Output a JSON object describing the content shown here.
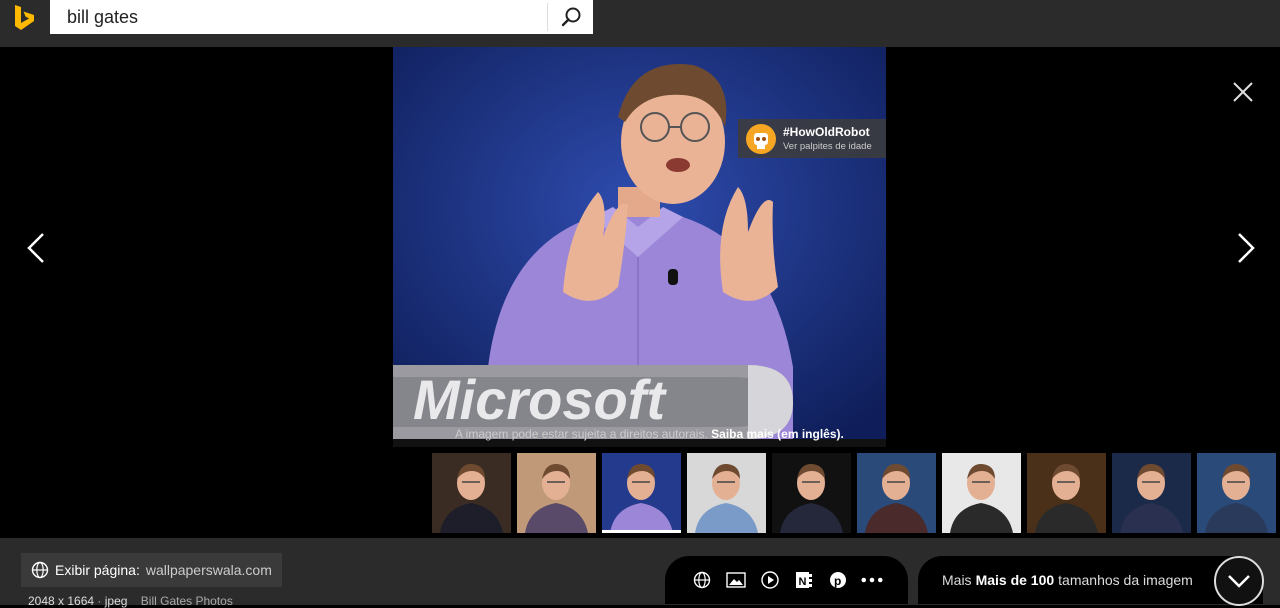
{
  "search": {
    "query": "bill gates"
  },
  "viewer": {
    "howold_title": "#HowOldRobot",
    "howold_subtitle": "Ver palpites de idade",
    "copyright_text": "A imagem pode estar sujeita a direitos autorais. ",
    "copyright_link": "Saiba mais (em inglês)",
    "copyright_end": ".",
    "podium_text": "Microsoft"
  },
  "thumbnails": [
    {
      "bg": "#3a2c22",
      "shirt": "#1e1e2a"
    },
    {
      "bg": "#c09a78",
      "shirt": "#5a4a6a"
    },
    {
      "bg": "#243a8c",
      "shirt": "#9c86d8"
    },
    {
      "bg": "#d8d8d8",
      "shirt": "#7a9ac8"
    },
    {
      "bg": "#111111",
      "shirt": "#24283a"
    },
    {
      "bg": "#2a4a7a",
      "shirt": "#4a2a2a"
    },
    {
      "bg": "#e8e8e8",
      "shirt": "#2a2a2a"
    },
    {
      "bg": "#4a3018",
      "shirt": "#2a2a2a"
    },
    {
      "bg": "#1c2a4a",
      "shirt": "#2a3050"
    },
    {
      "bg": "#2a4a7a",
      "shirt": "#2a3a5a"
    }
  ],
  "bottom": {
    "visit_label": "Exibir página:",
    "visit_domain": "wallpaperswala.com",
    "dimensions": "2048 x 1664",
    "separator": "·",
    "format": "jpeg",
    "related": "Bill Gates Photos",
    "more_sizes_prefix": "Mais",
    "more_sizes_bold": "Mais de 100",
    "more_sizes_suffix": "tamanhos da imagem"
  },
  "colors": {
    "accent": "#ffb900",
    "topbar": "#2b2b2b",
    "howold": "#f6a623"
  }
}
